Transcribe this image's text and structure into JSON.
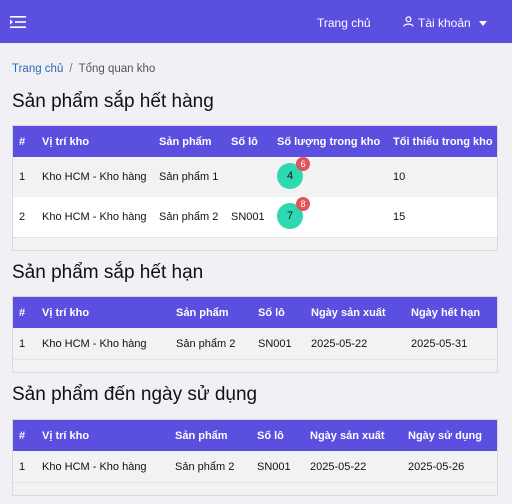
{
  "topbar": {
    "menu_icon": "hamburger-menu-icon",
    "home_label": "Trang chủ",
    "account_label": "Tài khoản",
    "account_icon": "user-icon",
    "bg_color": "#5b4fe0"
  },
  "breadcrumb": {
    "home": "Trang chủ",
    "separator": "/",
    "current": "Tổng quan kho"
  },
  "sections": {
    "low_stock": {
      "title": "Sản phẩm sắp hết hàng",
      "headers": [
        "#",
        "Vị trí kho",
        "Sản phẩm",
        "Số lô",
        "Số lượng trong kho",
        "Tối thiểu trong kho"
      ],
      "rows": [
        {
          "no": "1",
          "location": "Kho HCM - Kho hàng",
          "product": "Sản phẩm 1",
          "lot": "",
          "qty": "4",
          "badge": "6",
          "min": "10"
        },
        {
          "no": "2",
          "location": "Kho HCM - Kho hàng",
          "product": "Sản phẩm 2",
          "lot": "SN001",
          "qty": "7",
          "badge": "8",
          "min": "15"
        }
      ]
    },
    "expiring": {
      "title": "Sản phẩm sắp hết hạn",
      "headers": [
        "#",
        "Vị trí kho",
        "Sản phẩm",
        "Số lô",
        "Ngày sản xuất",
        "Ngày hết hạn"
      ],
      "rows": [
        {
          "no": "1",
          "location": "Kho HCM - Kho hàng",
          "product": "Sản phẩm 2",
          "lot": "SN001",
          "mfg": "2025-05-22",
          "date": "2025-05-31"
        }
      ]
    },
    "use_by": {
      "title": "Sản phẩm đến ngày sử dụng",
      "headers": [
        "#",
        "Vị trí kho",
        "Sản phẩm",
        "Số lô",
        "Ngày sản xuất",
        "Ngày sử dụng"
      ],
      "rows": [
        {
          "no": "1",
          "location": "Kho HCM - Kho hàng",
          "product": "Sản phẩm 2",
          "lot": "SN001",
          "mfg": "2025-05-22",
          "date": "2025-05-26"
        }
      ]
    }
  },
  "colors": {
    "header_bg": "#5b4fe0",
    "qty_bubble": "#2ed8b0",
    "badge": "#e2535a"
  }
}
